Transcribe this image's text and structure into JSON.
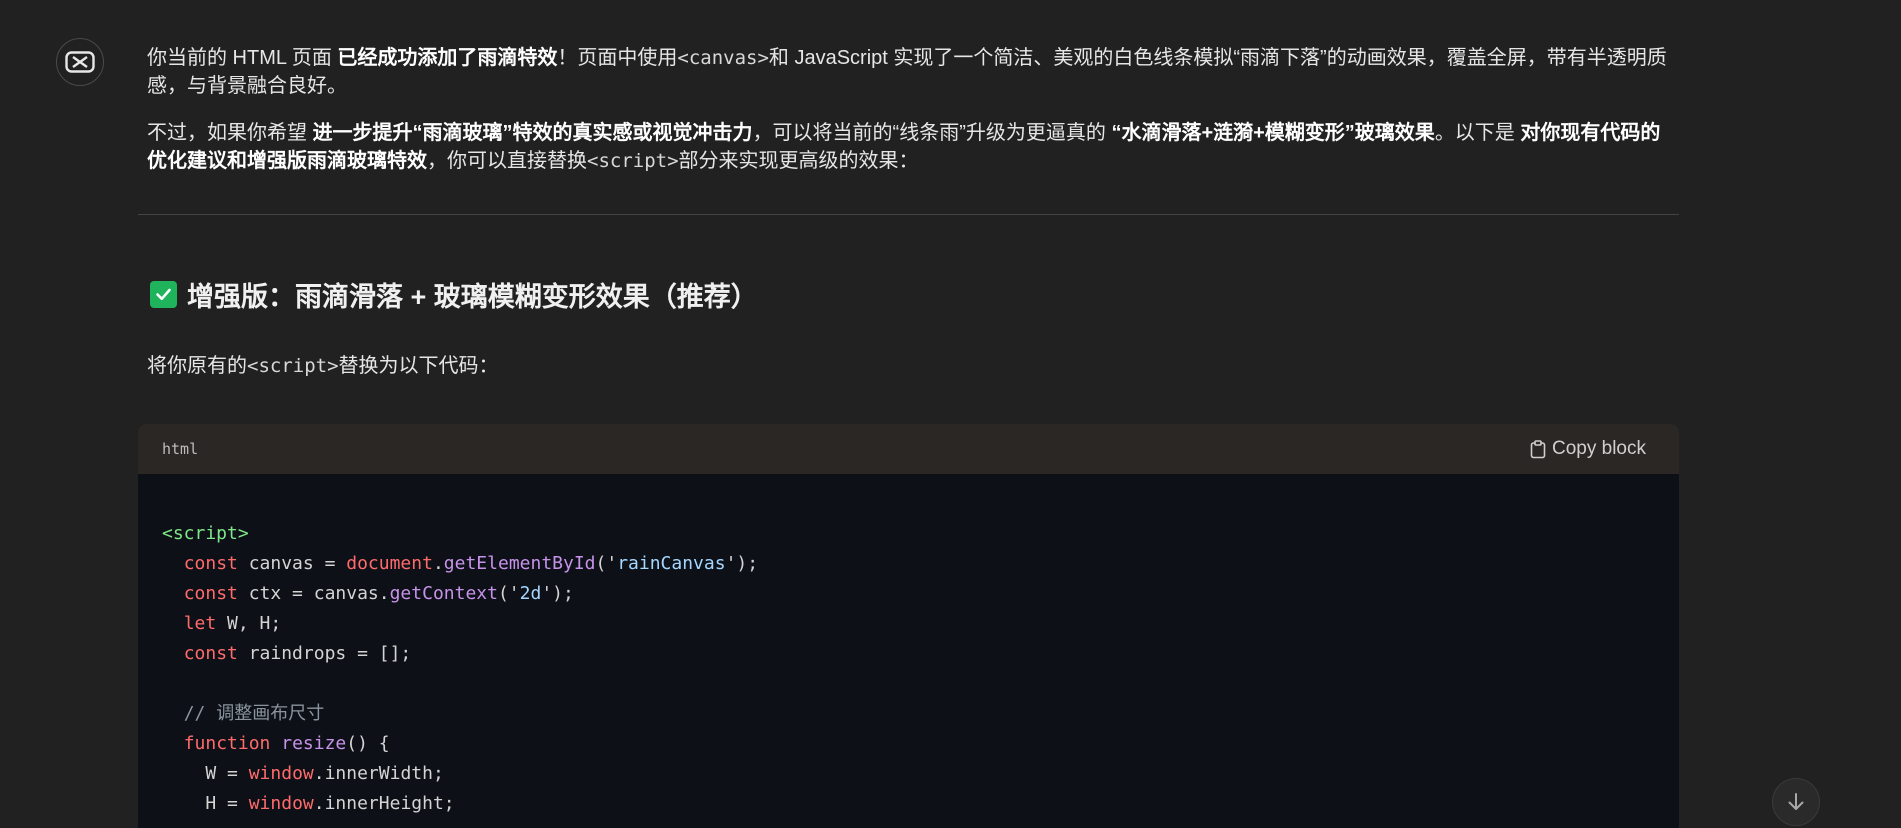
{
  "assistant": {
    "avatar_icon": "infinity-logo-icon"
  },
  "message": {
    "p1": {
      "t1": "你当前的 HTML 页面 ",
      "b1": "已经成功添加了雨滴特效",
      "t2": "！页面中使用",
      "c1": "<canvas>",
      "t3": "和 JavaScript 实现了一个简洁、美观的白色线条模拟“雨滴下落”的动画效果，覆盖全屏，带有半透明质感，与背景融合良好。"
    },
    "p2": {
      "t1": "不过，如果你希望 ",
      "b1": "进一步提升“雨滴玻璃”特效的真实感或视觉冲击力",
      "t2": "，可以将当前的“线条雨”升级为更逼真的 ",
      "b2": "“水滴滑落+涟漪+模糊变形”玻璃效果",
      "t3": "。以下是 ",
      "b3": "对你现有代码的优化建议和增强版雨滴玻璃特效",
      "t4": "，你可以直接替换",
      "c1": "<script>",
      "t5": "部分来实现更高级的效果："
    },
    "heading": "增强版：雨滴滑落 + 玻璃模糊变形效果（推荐）",
    "heading_icon": "check-mark-icon",
    "intro": {
      "t1": "将你原有的",
      "c1": "<script>",
      "t2": "替换为以下代码："
    }
  },
  "codeblock": {
    "language": "html",
    "copy_label": "Copy block",
    "copy_icon": "clipboard-icon",
    "lines": {
      "l1_tag": "<script>",
      "l2_kw": "const",
      "l2_a": " canvas = ",
      "l2_obj": "document",
      "l2_dot": ".",
      "l2_fn": "getElementById",
      "l2_p1": "('",
      "l2_str": "rainCanvas",
      "l2_p2": "');",
      "l3_kw": "const",
      "l3_a": " ctx = canvas.",
      "l3_fn": "getContext",
      "l3_p1": "('",
      "l3_str": "2d",
      "l3_p2": "');",
      "l4_kw": "let",
      "l4_a": " W, H;",
      "l5_kw": "const",
      "l5_a": " raindrops = [];",
      "l6_cm": "// 调整画布尺寸",
      "l7_kw": "function",
      "l7_sp": " ",
      "l7_fn": "resize",
      "l7_a": "() {",
      "l8_a": "W = ",
      "l8_obj": "window",
      "l8_b": ".innerWidth;",
      "l9_a": "H = ",
      "l9_obj": "window",
      "l9_b": ".innerHeight;"
    }
  },
  "scroll_button_icon": "arrow-down-icon",
  "colors": {
    "background": "#212121",
    "code_background": "#0d1117",
    "code_header": "#2a2725",
    "check_green": "#1fb35c"
  }
}
